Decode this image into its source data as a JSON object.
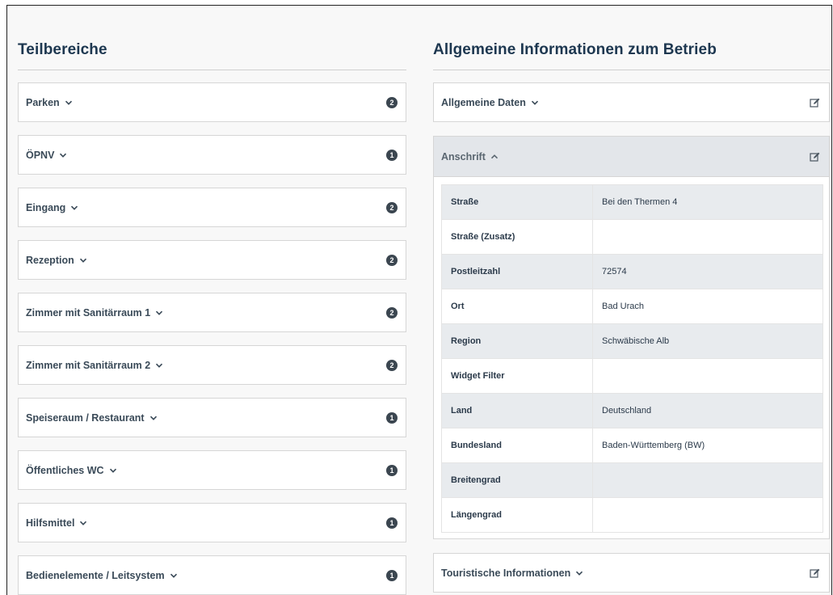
{
  "left": {
    "heading": "Teilbereiche",
    "items": [
      {
        "label": "Parken",
        "count": "2"
      },
      {
        "label": "ÖPNV",
        "count": "1"
      },
      {
        "label": "Eingang",
        "count": "2"
      },
      {
        "label": "Rezeption",
        "count": "2"
      },
      {
        "label": "Zimmer mit Sanitärraum 1",
        "count": "2"
      },
      {
        "label": "Zimmer mit Sanitärraum 2",
        "count": "2"
      },
      {
        "label": "Speiseraum / Restaurant",
        "count": "1"
      },
      {
        "label": "Öffentliches WC",
        "count": "1"
      },
      {
        "label": "Hilfsmittel",
        "count": "1"
      },
      {
        "label": "Bedienelemente / Leitsystem",
        "count": "1"
      }
    ]
  },
  "right": {
    "heading": "Allgemeine Informationen zum Betrieb",
    "sections": {
      "general": {
        "label": "Allgemeine Daten"
      },
      "address": {
        "label": "Anschrift",
        "rows": [
          {
            "key": "Straße",
            "value": "Bei den Thermen 4"
          },
          {
            "key": "Straße (Zusatz)",
            "value": ""
          },
          {
            "key": "Postleitzahl",
            "value": "72574"
          },
          {
            "key": "Ort",
            "value": "Bad Urach"
          },
          {
            "key": "Region",
            "value": "Schwäbische Alb"
          },
          {
            "key": "Widget Filter",
            "value": ""
          },
          {
            "key": "Land",
            "value": "Deutschland"
          },
          {
            "key": "Bundesland",
            "value": "Baden-Württemberg (BW)"
          },
          {
            "key": "Breitengrad",
            "value": ""
          },
          {
            "key": "Längengrad",
            "value": ""
          }
        ]
      },
      "tourist": {
        "label": "Touristische Informationen"
      }
    }
  },
  "icons": {
    "chevron_down": "chevron-down-icon",
    "chevron_up": "chevron-up-icon",
    "edit": "edit-icon"
  }
}
